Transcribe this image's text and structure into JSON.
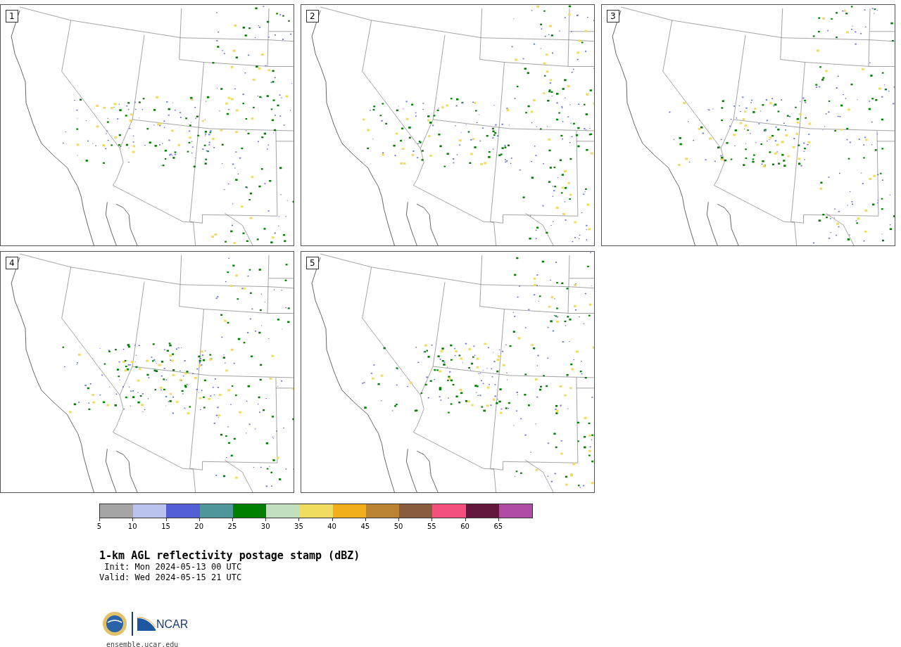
{
  "panels": [
    {
      "label": "1"
    },
    {
      "label": "2"
    },
    {
      "label": "3"
    },
    {
      "label": "4"
    },
    {
      "label": "5"
    }
  ],
  "colorbar": {
    "segments": [
      {
        "color": "#a5a5a5"
      },
      {
        "color": "#b9c3ee"
      },
      {
        "color": "#525fd6"
      },
      {
        "color": "#4f979b"
      },
      {
        "color": "#008000"
      },
      {
        "color": "#bfdfbf"
      },
      {
        "color": "#f0dc5e"
      },
      {
        "color": "#f0ae1a"
      },
      {
        "color": "#ba8432"
      },
      {
        "color": "#8a5c3e"
      },
      {
        "color": "#f5507c"
      },
      {
        "color": "#61163a"
      },
      {
        "color": "#ae4ca3"
      }
    ],
    "ticks": [
      "5",
      "10",
      "15",
      "20",
      "25",
      "30",
      "35",
      "40",
      "45",
      "50",
      "55",
      "60",
      "65"
    ]
  },
  "title": "1-km AGL reflectivity postage stamp (dBZ)",
  "init": " Init: Mon 2024-05-13 00 UTC",
  "valid": "Valid: Wed 2024-05-15 21 UTC",
  "logo": {
    "text": "NCAR"
  },
  "footer": "ensemble.ucar.edu"
}
